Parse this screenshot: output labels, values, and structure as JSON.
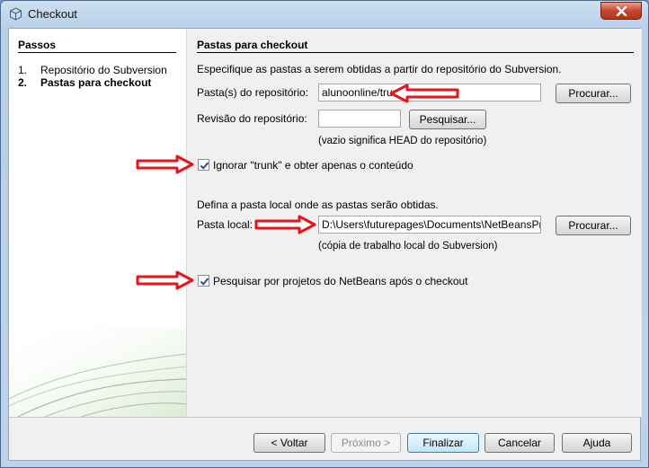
{
  "window": {
    "title": "Checkout"
  },
  "steps": {
    "header": "Passos",
    "items": [
      {
        "num": "1.",
        "label": "Repositório do Subversion"
      },
      {
        "num": "2.",
        "label": "Pastas para checkout"
      }
    ]
  },
  "main": {
    "title": "Pastas para checkout",
    "intro": "Especifique as pastas a serem obtidas a partir do repositório do Subversion.",
    "repo_folder": {
      "label": "Pasta(s) do repositório:",
      "value": "alunoonline/trunk",
      "browse_label": "Procurar..."
    },
    "revision": {
      "label": "Revisão do repositório:",
      "value": "",
      "search_label": "Pesquisar...",
      "hint": "(vazio significa HEAD do repositório)"
    },
    "skip_trunk": {
      "label": "Ignorar \"trunk\" e obter apenas o conteúdo",
      "checked": true
    },
    "local_intro": "Defina a pasta local onde as pastas serão obtidas.",
    "local_folder": {
      "label": "Pasta local:",
      "value": "D:\\Users\\futurepages\\Documents\\NetBeansProje...",
      "browse_label": "Procurar...",
      "hint": "(cópia de trabalho local do Subversion)"
    },
    "scan_projects": {
      "label": "Pesquisar por projetos do NetBeans após o checkout",
      "checked": true
    }
  },
  "footer": {
    "back": "< Voltar",
    "next": "Próximo >",
    "finish": "Finalizar",
    "cancel": "Cancelar",
    "help": "Ajuda"
  },
  "colors": {
    "annotation_arrow": "#e8141c",
    "accent": "#3c7fb1"
  }
}
